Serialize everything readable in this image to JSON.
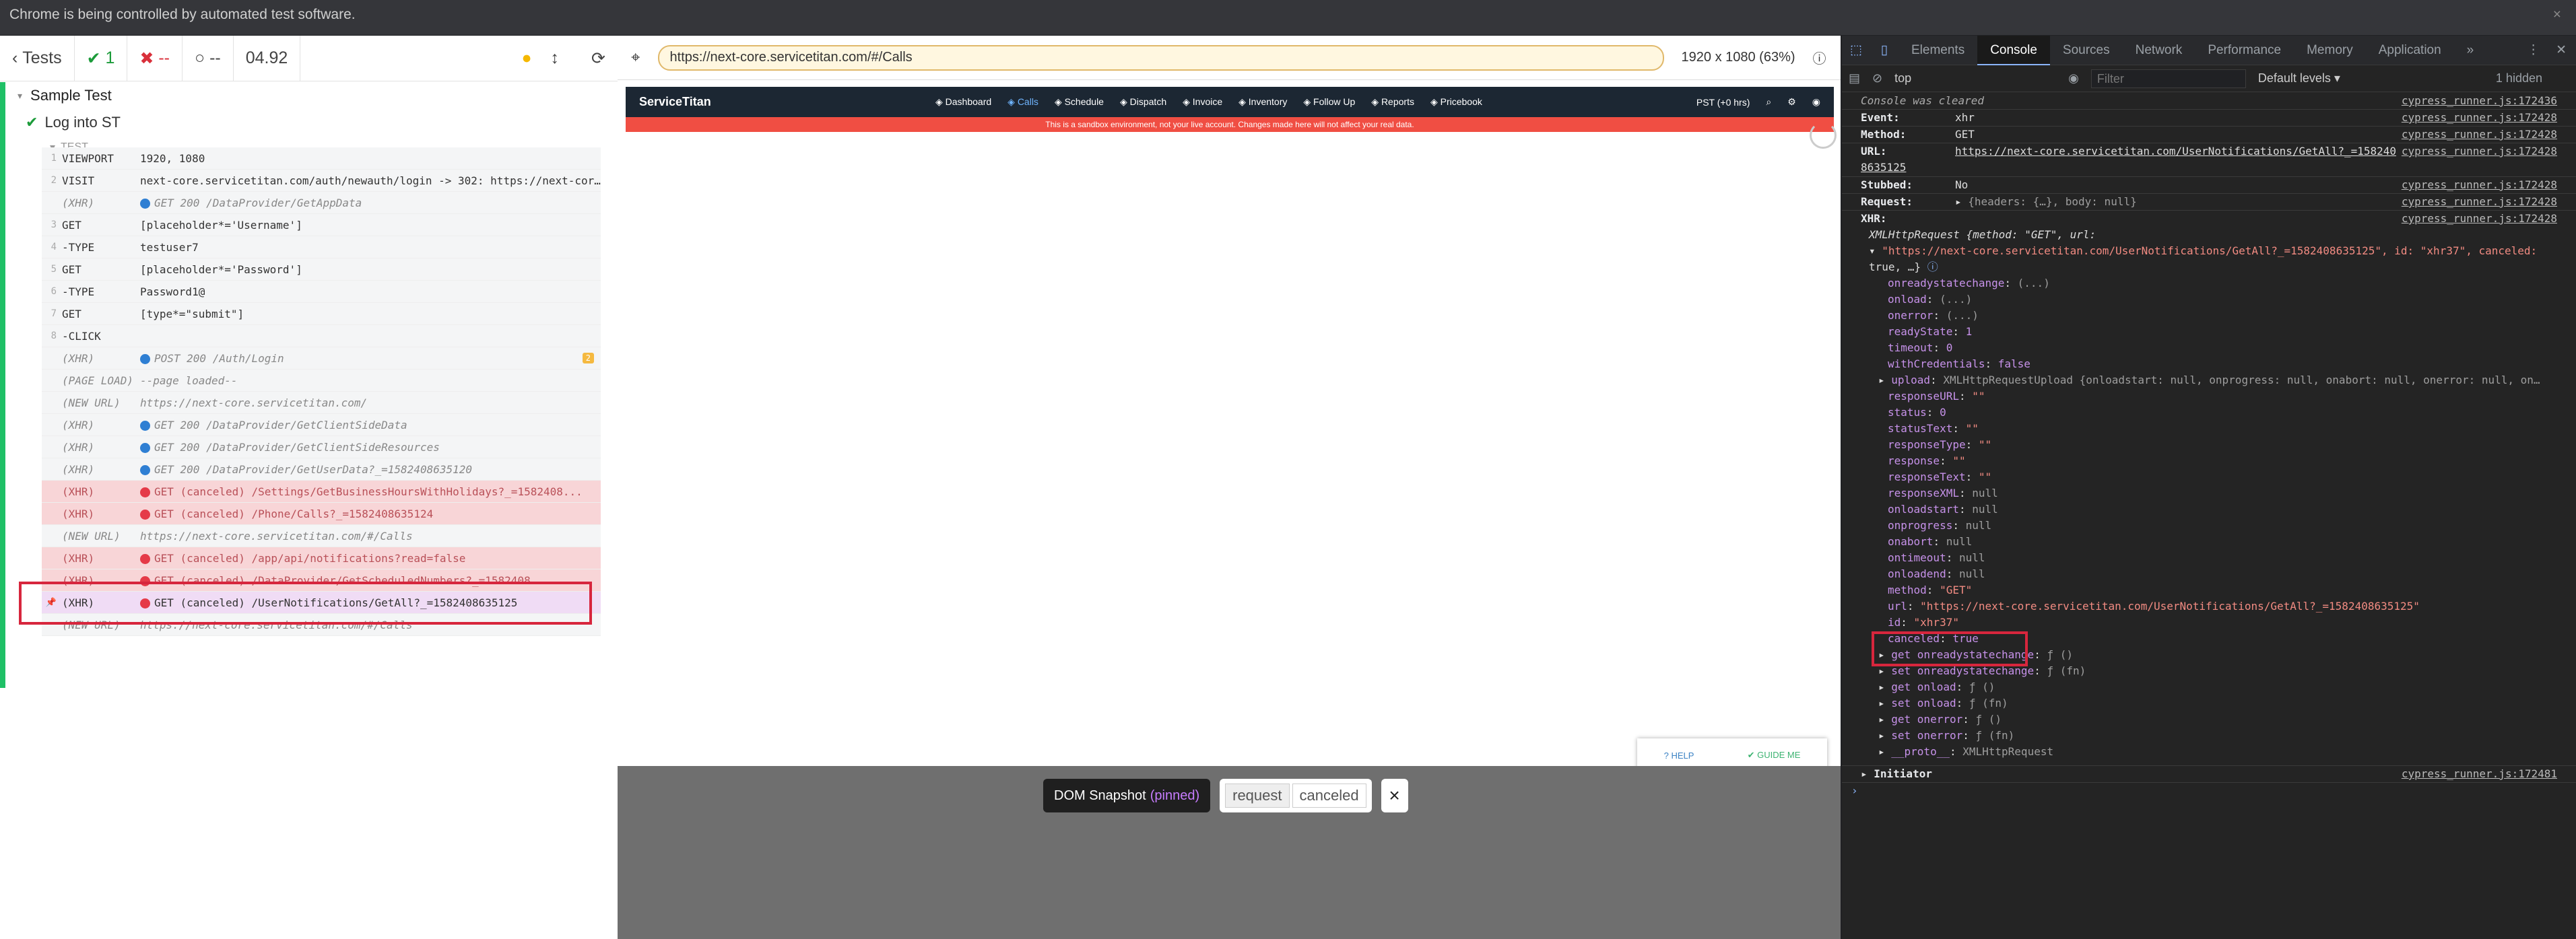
{
  "browser": {
    "banner": "Chrome is being controlled by automated test software.",
    "close": "×"
  },
  "reporter": {
    "header": {
      "back": "Tests",
      "passed": "1",
      "failed": "--",
      "pending": "--",
      "duration": "04.92"
    },
    "suite": "Sample Test",
    "test": "Log into ST",
    "section": "TEST",
    "commands": [
      {
        "num": "1",
        "name": "VIEWPORT",
        "msg": "1920, 1080",
        "kind": "normal"
      },
      {
        "num": "2",
        "name": "VISIT",
        "msg": "next-core.servicetitan.com/auth/newauth/login -> 302: https://next-core.servicetitan.com/...",
        "kind": "normal"
      },
      {
        "num": "",
        "name": "(XHR)",
        "msg": "GET 200 /DataProvider/GetAppData",
        "kind": "faint",
        "dot": "b"
      },
      {
        "num": "3",
        "name": "GET",
        "msg": "[placeholder*='Username']",
        "kind": "normal"
      },
      {
        "num": "4",
        "name": "-TYPE",
        "msg": "testuser7",
        "kind": "normal"
      },
      {
        "num": "5",
        "name": "GET",
        "msg": "[placeholder*='Password']",
        "kind": "normal"
      },
      {
        "num": "6",
        "name": "-TYPE",
        "msg": "Password1@",
        "kind": "normal"
      },
      {
        "num": "7",
        "name": "GET",
        "msg": "[type*=\"submit\"]",
        "kind": "normal"
      },
      {
        "num": "8",
        "name": "-CLICK",
        "msg": "",
        "kind": "normal"
      },
      {
        "num": "",
        "name": "(XHR)",
        "msg": "POST 200 /Auth/Login",
        "kind": "faint",
        "dot": "b",
        "badge": "2"
      },
      {
        "num": "",
        "name": "(PAGE LOAD)",
        "msg": "--page loaded--",
        "kind": "faint"
      },
      {
        "num": "",
        "name": "(NEW URL)",
        "msg": "https://next-core.servicetitan.com/",
        "kind": "faint"
      },
      {
        "num": "",
        "name": "(XHR)",
        "msg": "GET 200 /DataProvider/GetClientSideData",
        "kind": "faint",
        "dot": "b"
      },
      {
        "num": "",
        "name": "(XHR)",
        "msg": "GET 200 /DataProvider/GetClientSideResources",
        "kind": "faint",
        "dot": "b"
      },
      {
        "num": "",
        "name": "(XHR)",
        "msg": "GET 200 /DataProvider/GetUserData?_=1582408635120",
        "kind": "faint",
        "dot": "b"
      },
      {
        "num": "",
        "name": "(XHR)",
        "msg": "GET (canceled) /Settings/GetBusinessHoursWithHolidays?_=1582408...",
        "kind": "err",
        "dot": "r"
      },
      {
        "num": "",
        "name": "(XHR)",
        "msg": "GET (canceled) /Phone/Calls?_=1582408635124",
        "kind": "err",
        "dot": "r"
      },
      {
        "num": "",
        "name": "(NEW URL)",
        "msg": "https://next-core.servicetitan.com/#/Calls",
        "kind": "faint"
      },
      {
        "num": "",
        "name": "(XHR)",
        "msg": "GET (canceled) /app/api/notifications?read=false",
        "kind": "err",
        "dot": "r"
      },
      {
        "num": "",
        "name": "(XHR)",
        "msg": "GET (canceled) /DataProvider/GetScheduledNumbers?_=1582408...",
        "kind": "err",
        "dot": "r"
      },
      {
        "num": "",
        "name": "(XHR)",
        "msg": "GET (canceled) /UserNotifications/GetAll?_=1582408635125",
        "kind": "pinned",
        "dot": "r"
      },
      {
        "num": "",
        "name": "(NEW URL)",
        "msg": "https://next-core.servicetitan.com/#/Calls",
        "kind": "faint"
      }
    ]
  },
  "aut": {
    "url": "https://next-core.servicetitan.com/#/Calls",
    "viewport": "1920 x 1080 (63%)",
    "nav": {
      "logo": "ServiceTitan",
      "items": [
        "Dashboard",
        "Calls",
        "Schedule",
        "Dispatch",
        "Invoice",
        "Inventory",
        "Follow Up",
        "Reports",
        "Pricebook"
      ],
      "timezone": "PST (+0 hrs)"
    },
    "sandbox": "This is a sandbox environment, not your live account. Changes made here will not affect your real data.",
    "help": "HELP",
    "guide": "GUIDE ME",
    "snapshot": {
      "label": "DOM Snapshot",
      "pinned": "(pinned)",
      "request": "request",
      "canceled": "canceled",
      "close": "×"
    }
  },
  "devtools": {
    "tabs": [
      "Elements",
      "Console",
      "Sources",
      "Network",
      "Performance",
      "Memory",
      "Application"
    ],
    "more": "»",
    "context": "top",
    "filter_placeholder": "Filter",
    "levels": "Default levels ▾",
    "hidden": "1 hidden",
    "src1": "cypress_runner.js:172436",
    "src2": "cypress_runner.js:172428",
    "src3": "cypress_runner.js:172481",
    "cleared": "Console was cleared",
    "event_k": "Event:",
    "event_v": "xhr",
    "method_k": "Method:",
    "method_v": "GET",
    "url_k": "URL:",
    "url_v": "https://next-core.servicetitan.com/UserNotifications/GetAll?_=1582408635125",
    "stubbed_k": "Stubbed:",
    "stubbed_v": "No",
    "request_k": "Request:",
    "request_v": "{headers: {…}, body: null}",
    "xhr_k": "XHR:",
    "xhr_head": "XMLHttpRequest {method: \"GET\", url:",
    "xhr_head2": "\"https://next-core.servicetitan.com/UserNotifications/GetAll?_=1582408635125\", id: \"xhr37\", canceled:",
    "xhr_head3": "true, …}",
    "props": [
      {
        "k": "onreadystatechange",
        "v": "(...)",
        "c": "nv"
      },
      {
        "k": "onload",
        "v": "(...)",
        "c": "nv"
      },
      {
        "k": "onerror",
        "v": "(...)",
        "c": "nv"
      },
      {
        "k": "readyState",
        "v": "1",
        "c": "bv"
      },
      {
        "k": "timeout",
        "v": "0",
        "c": "bv"
      },
      {
        "k": "withCredentials",
        "v": "false",
        "c": "bv"
      },
      {
        "k": "upload",
        "v": "XMLHttpRequestUpload {onloadstart: null, onprogress: null, onabort: null, onerror: null, on…",
        "c": "nv",
        "tri": true
      },
      {
        "k": "responseURL",
        "v": "\"\"",
        "c": "sv"
      },
      {
        "k": "status",
        "v": "0",
        "c": "bv"
      },
      {
        "k": "statusText",
        "v": "\"\"",
        "c": "sv"
      },
      {
        "k": "responseType",
        "v": "\"\"",
        "c": "sv"
      },
      {
        "k": "response",
        "v": "\"\"",
        "c": "sv"
      },
      {
        "k": "responseText",
        "v": "\"\"",
        "c": "sv"
      },
      {
        "k": "responseXML",
        "v": "null",
        "c": "nv"
      },
      {
        "k": "onloadstart",
        "v": "null",
        "c": "nv"
      },
      {
        "k": "onprogress",
        "v": "null",
        "c": "nv"
      },
      {
        "k": "onabort",
        "v": "null",
        "c": "nv"
      },
      {
        "k": "ontimeout",
        "v": "null",
        "c": "nv"
      },
      {
        "k": "onloadend",
        "v": "null",
        "c": "nv"
      },
      {
        "k": "method",
        "v": "\"GET\"",
        "c": "sv"
      },
      {
        "k": "url",
        "v": "\"https://next-core.servicetitan.com/UserNotifications/GetAll?_=1582408635125\"",
        "c": "sv"
      },
      {
        "k": "id",
        "v": "\"xhr37\"",
        "c": "sv"
      },
      {
        "k": "canceled",
        "v": "true",
        "c": "bv"
      },
      {
        "k": "get onreadystatechange",
        "v": "ƒ ()",
        "c": "nv",
        "tri": true
      },
      {
        "k": "set onreadystatechange",
        "v": "ƒ (fn)",
        "c": "nv",
        "tri": true
      },
      {
        "k": "get onload",
        "v": "ƒ ()",
        "c": "nv",
        "tri": true
      },
      {
        "k": "set onload",
        "v": "ƒ (fn)",
        "c": "nv",
        "tri": true
      },
      {
        "k": "get onerror",
        "v": "ƒ ()",
        "c": "nv",
        "tri": true
      },
      {
        "k": "set onerror",
        "v": "ƒ (fn)",
        "c": "nv",
        "tri": true
      },
      {
        "k": "__proto__",
        "v": "XMLHttpRequest",
        "c": "nv",
        "tri": true
      }
    ],
    "initiator": "Initiator",
    "prompt": "›"
  }
}
